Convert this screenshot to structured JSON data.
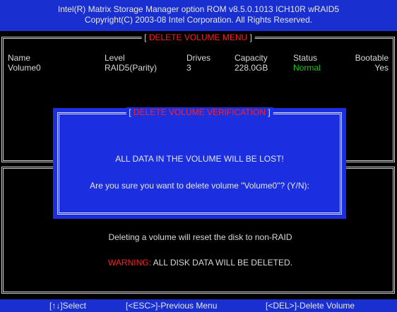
{
  "header": {
    "line1": "Intel(R) Matrix Storage Manager option ROM v8.5.0.1013 ICH10R wRAID5",
    "line2": "Copyright(C) 2003-08 Intel Corporation.  All Rights Reserved."
  },
  "menu": {
    "title": "DELETE VOLUME MENU",
    "columns": [
      "Name",
      "Level",
      "Drives",
      "Capacity",
      "Status",
      "Bootable"
    ],
    "row": {
      "name": "Volume0",
      "level": "RAID5(Parity)",
      "drives": "3",
      "capacity": "228.0GB",
      "status": "Normal",
      "bootable": "Yes"
    }
  },
  "dialog": {
    "title": "DELETE VOLUME VERIFICATION",
    "line1": "ALL DATA IN THE VOLUME WILL BE LOST!",
    "line2": "Are you sure you want to delete volume \"Volume0\"? (Y/N):"
  },
  "help": {
    "line1": "Deleting a volume will reset the disk to non-RAID",
    "warning_label": "WARNING:",
    "warning_text": " ALL DISK DATA WILL BE DELETED."
  },
  "footer": {
    "select": "[↑↓]Select",
    "esc": "[<ESC>]-Previous Menu",
    "del": "[<DEL>]-Delete Volume"
  },
  "colors": {
    "header_bg": "#1a2fcf",
    "dialog_bg": "#1b2fe0",
    "alert": "#ff2020",
    "status_ok": "#19c919"
  }
}
